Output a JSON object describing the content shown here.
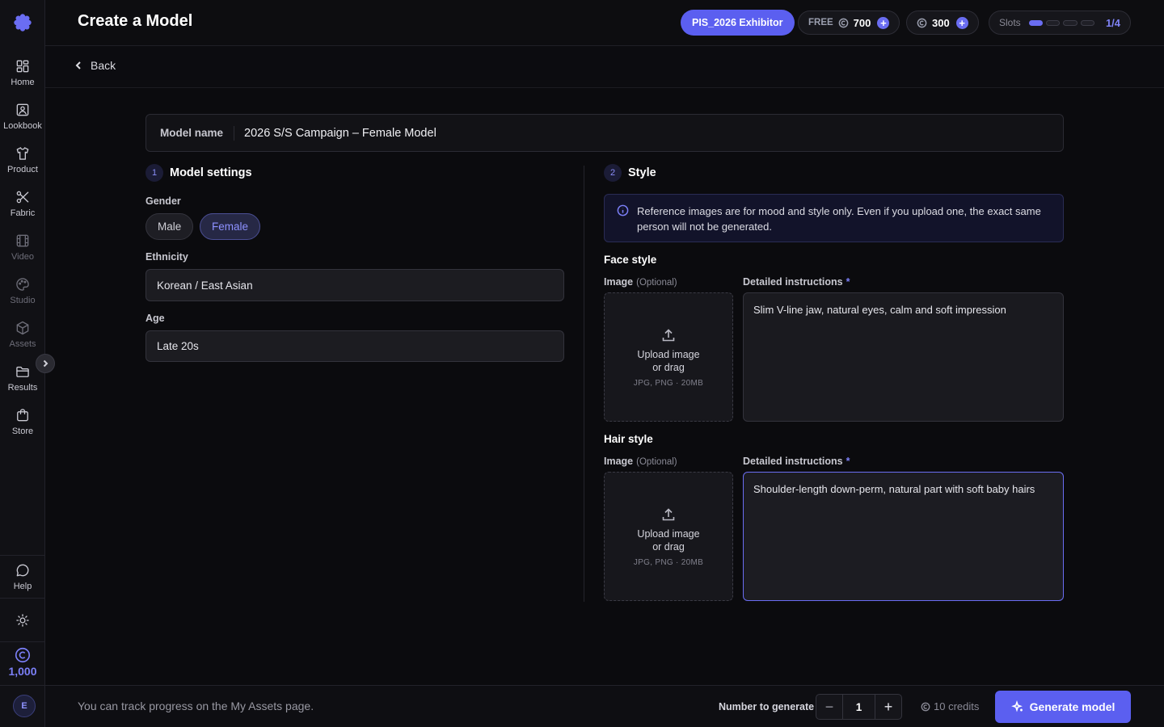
{
  "header": {
    "title": "Create a Model",
    "exhibitor_badge": "PIS_2026 Exhibitor",
    "free_label": "FREE",
    "free_credits": "700",
    "paid_credits": "300",
    "slots_label": "Slots",
    "slots_used": "1/4",
    "slots_filled_fraction": 0.25
  },
  "sidebar": {
    "items": [
      {
        "label": "Home",
        "icon": "grid-icon"
      },
      {
        "label": "Lookbook",
        "icon": "image-icon"
      },
      {
        "label": "Product",
        "icon": "shirt-icon"
      },
      {
        "label": "Fabric",
        "icon": "scissors-icon"
      },
      {
        "label": "Video",
        "icon": "film-icon"
      },
      {
        "label": "Studio",
        "icon": "palette-icon"
      },
      {
        "label": "Assets",
        "icon": "box-icon"
      },
      {
        "label": "Results",
        "icon": "folder-icon"
      },
      {
        "label": "Store",
        "icon": "bag-icon"
      }
    ],
    "help_label": "Help",
    "credits": "1,000",
    "avatar_initial": "E"
  },
  "nav": {
    "back_label": "Back"
  },
  "model_name": {
    "label": "Model name",
    "value": "2026 S/S Campaign – Female Model"
  },
  "settings": {
    "number": "1",
    "title": "Model settings",
    "gender_label": "Gender",
    "gender_options": [
      "Male",
      "Female"
    ],
    "gender_selected": "Female",
    "ethnicity_label": "Ethnicity",
    "ethnicity_value": "Korean / East Asian",
    "age_label": "Age",
    "age_value": "Late 20s"
  },
  "style": {
    "number": "2",
    "title": "Style",
    "info": "Reference images are for mood and style only. Even if you upload one, the exact same person will not be generated.",
    "image_label": "Image",
    "optional": "(Optional)",
    "instructions_label": "Detailed instructions",
    "required_mark": "*",
    "upload_text": "Upload image or drag",
    "upload_spec": "JPG, PNG · 20MB",
    "face": {
      "title": "Face style",
      "instructions": "Slim V-line jaw, natural eyes, calm and soft impression"
    },
    "hair": {
      "title": "Hair style",
      "instructions": "Shoulder-length down-perm, natural part with soft baby hairs"
    }
  },
  "footer": {
    "note": "You can track progress on the My Assets page.",
    "number_label": "Number to generate",
    "minus": "−",
    "quantity": "1",
    "plus": "+",
    "cost": "10 credits",
    "generate_label": "Generate model"
  },
  "colors": {
    "accent": "#5b5ff0",
    "background": "#0b0b0e"
  }
}
